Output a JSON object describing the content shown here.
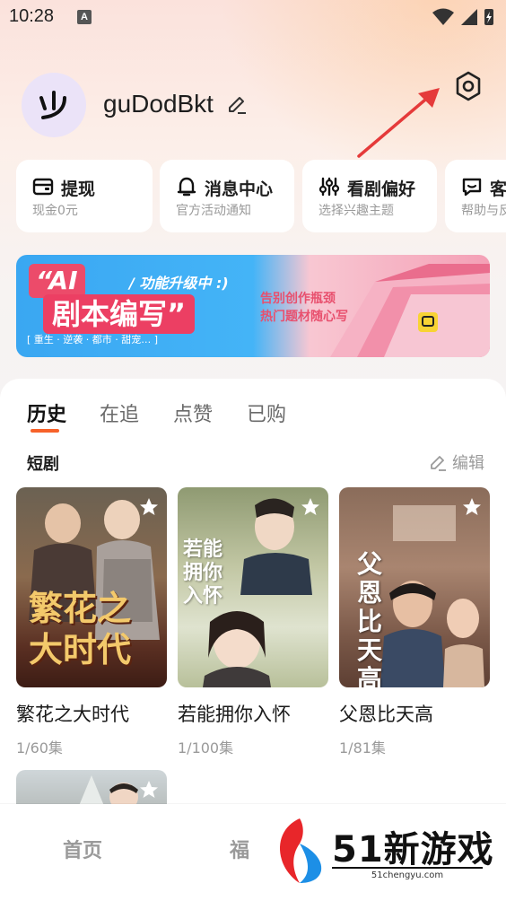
{
  "status_bar": {
    "time": "10:28",
    "notification_badge": "A"
  },
  "profile": {
    "avatar_text": "少",
    "username": "guDodBkt"
  },
  "quick_cards": [
    {
      "icon": "wallet-icon",
      "title": "提现",
      "subtitle": "现金0元"
    },
    {
      "icon": "bell-icon",
      "title": "消息中心",
      "subtitle": "官方活动通知"
    },
    {
      "icon": "sliders-icon",
      "title": "看剧偏好",
      "subtitle": "选择兴趣主题"
    },
    {
      "icon": "chat-icon",
      "title": "客",
      "subtitle": "帮助与反"
    }
  ],
  "banner": {
    "ai_label": "“AI",
    "tag": "/ 功能升级中 :)",
    "title": "剧本编写”",
    "genres": "[ 重生 · 逆袭 · 都市 · 甜宠… ]",
    "slogan_line1": "告别创作瓶颈",
    "slogan_line2": "热门题材随心写"
  },
  "tabs": [
    "历史",
    "在追",
    "点赞",
    "已购"
  ],
  "section": {
    "title": "短剧",
    "edit_label": "编辑"
  },
  "dramas": [
    {
      "title": "繁花之大时代",
      "progress": "1/60集",
      "poster_text": "繁花之大时代"
    },
    {
      "title": "若能拥你入怀",
      "progress": "1/100集",
      "poster_text": "若能拥你入怀"
    },
    {
      "title": "父恩比天高",
      "progress": "1/81集",
      "poster_text": "父恩比天高"
    }
  ],
  "bottom_nav": {
    "home": "首页",
    "welfare": "福"
  },
  "watermark": {
    "text": "51新游戏",
    "url": "51chengyu.com"
  },
  "colors": {
    "accent": "#f7622a",
    "banner_pink": "#ec3f63",
    "banner_blue": "#3aa7f2"
  }
}
